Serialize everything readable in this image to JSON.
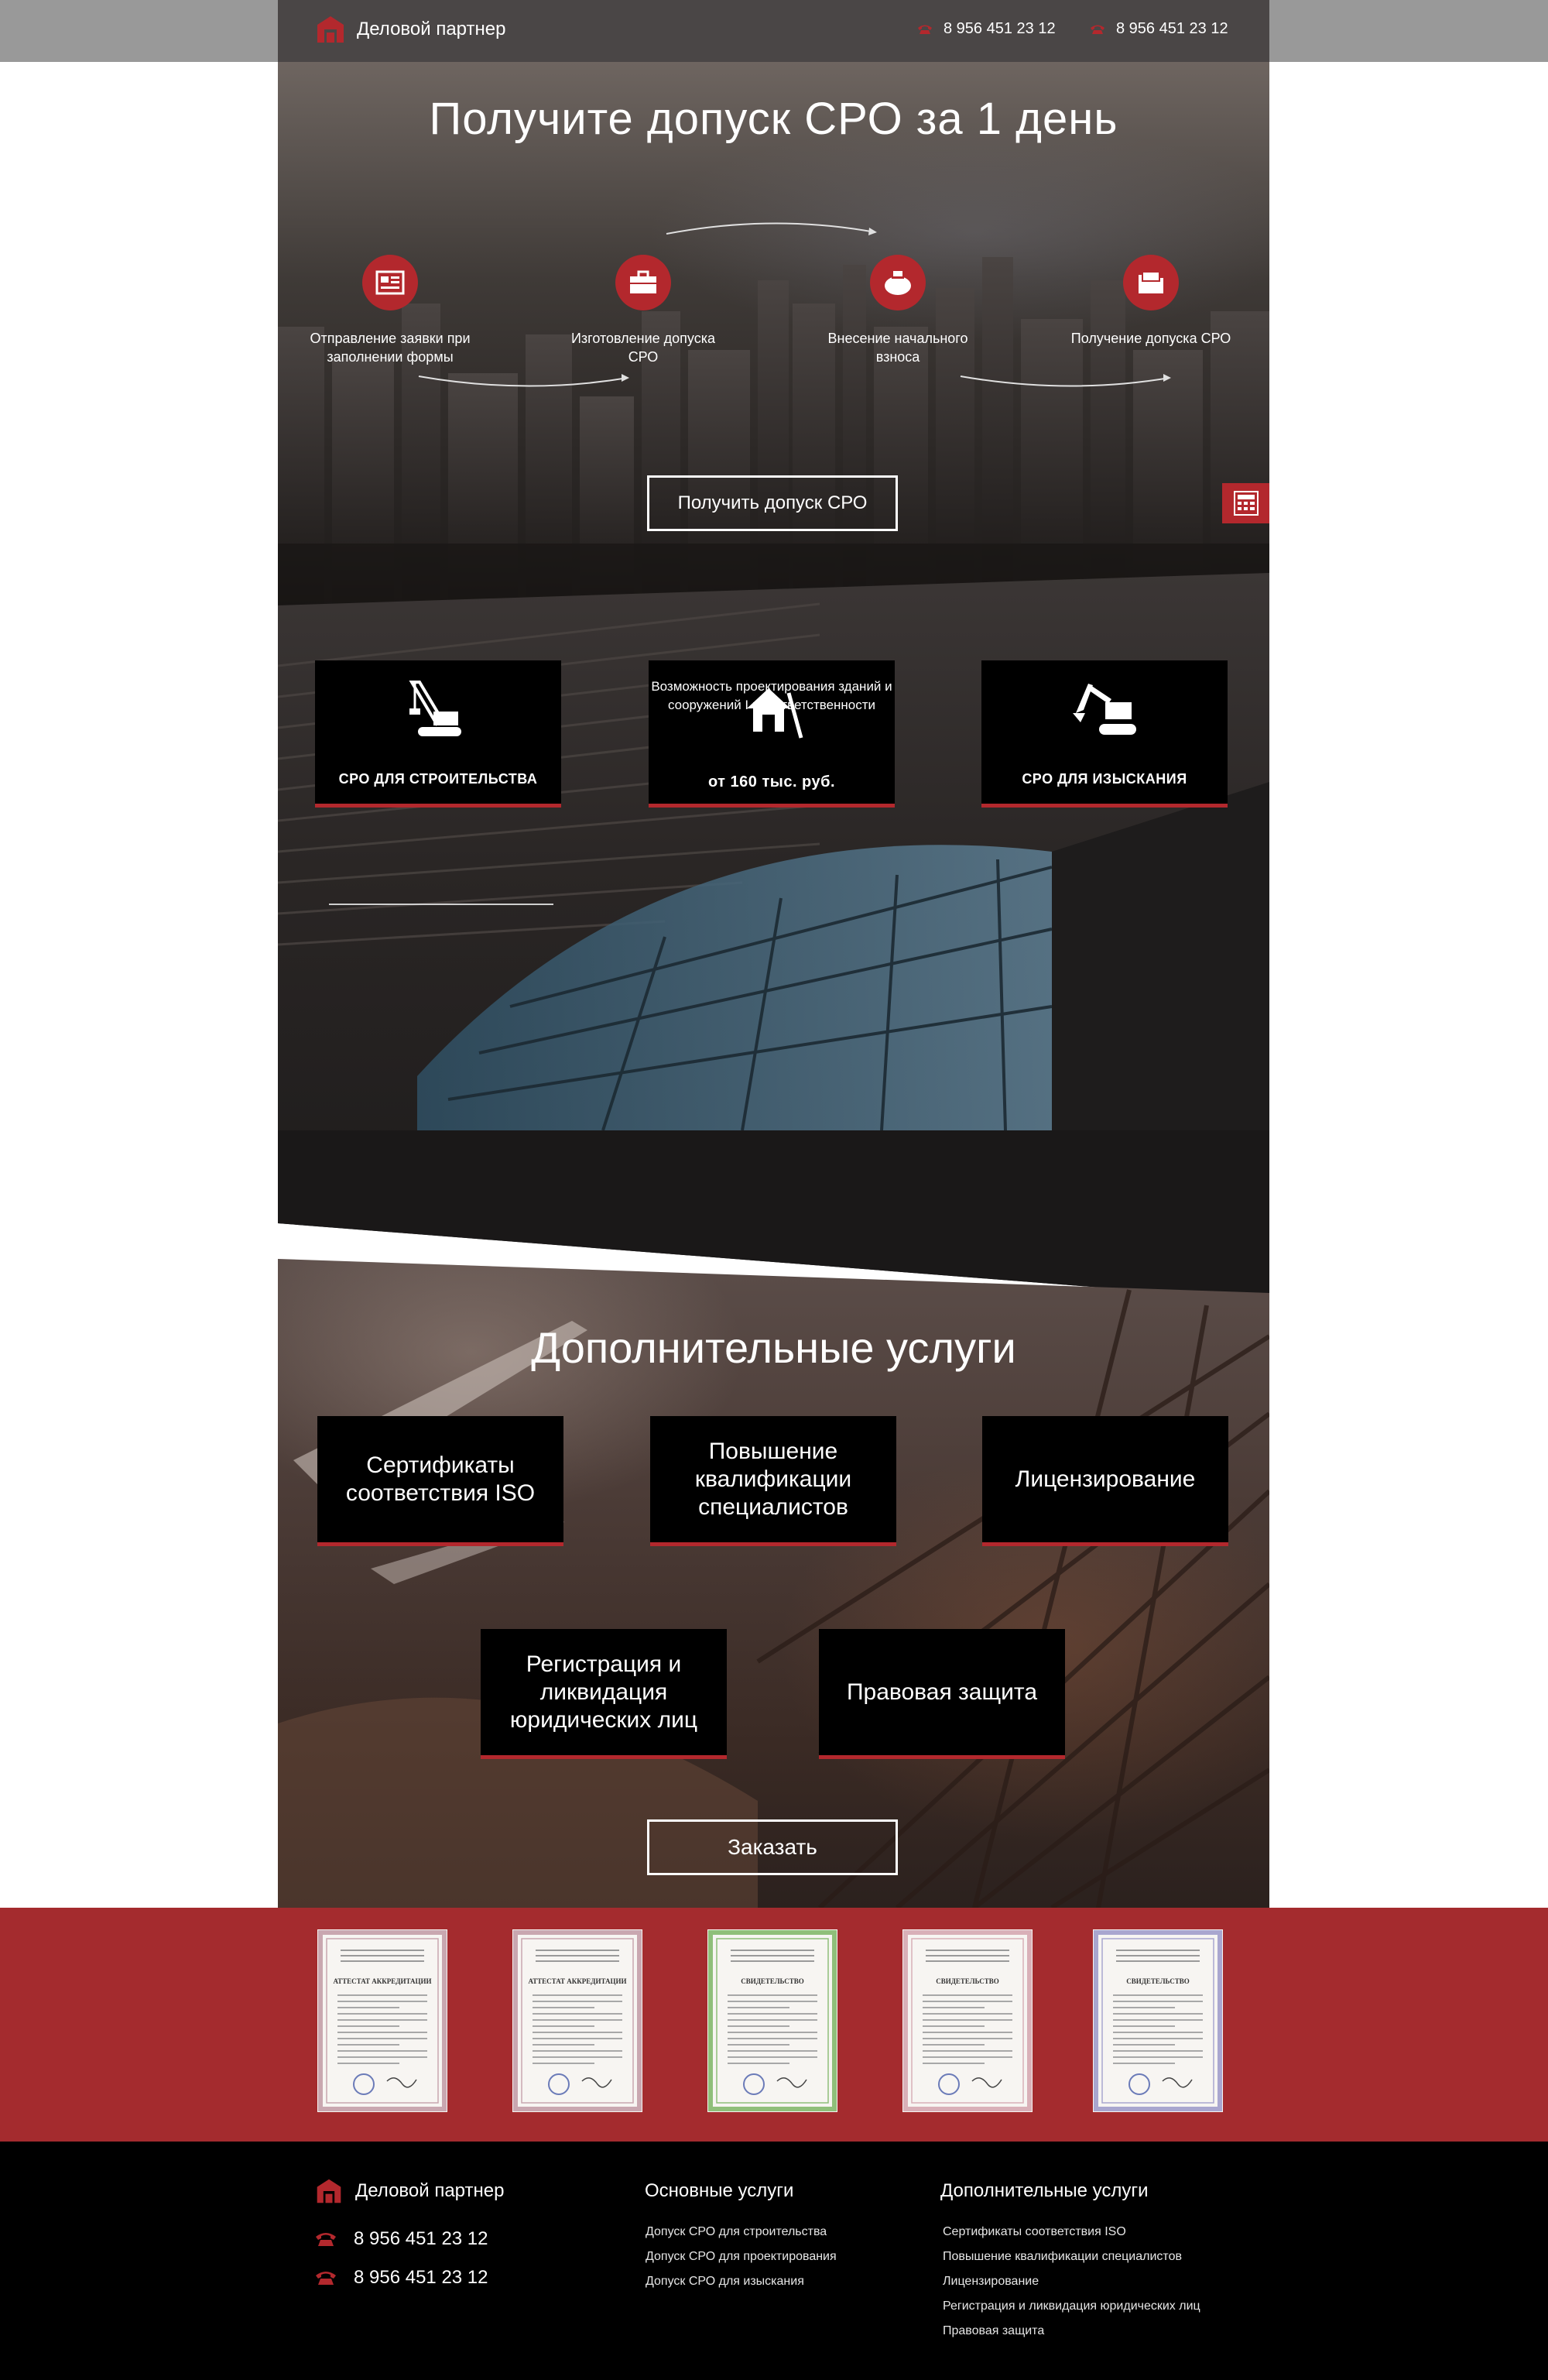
{
  "header": {
    "brand": "Деловой партнер",
    "phones": [
      "8 956 451 23 12",
      "8 956 451 23 12"
    ]
  },
  "hero": {
    "title": "Получите допуск СРО за 1 день",
    "steps": [
      {
        "label": "Отправление заявки при заполнении формы",
        "icon": "application-form-icon"
      },
      {
        "label": "Изготовление допуска СРО",
        "icon": "briefcase-icon"
      },
      {
        "label": "Внесение начального взноса",
        "icon": "money-bag-icon"
      },
      {
        "label": "Получение допуска СРО",
        "icon": "folder-icon"
      }
    ],
    "cta": "Получить допуск СРО",
    "calculator_icon": "calculator-icon"
  },
  "sro": {
    "cards": [
      {
        "title": "СРО ДЛЯ СТРОИТЕЛЬСТВА",
        "icon": "crane-icon"
      },
      {
        "subtitle": "Возможность проектирования зданий и сооружений I и II ответственности",
        "title": "от 160 тыс. руб.",
        "icon": "house-design-icon"
      },
      {
        "title": "СРО ДЛЯ ИЗЫСКАНИЯ",
        "icon": "excavator-icon"
      }
    ]
  },
  "extra": {
    "title": "Дополнительные услуги",
    "services": [
      "Сертификаты соответствия ISO",
      "Повышение квалификации специалистов",
      "Лицензирование",
      "Регистрация и ликвидация юридических лиц",
      "Правовая защита"
    ],
    "cta": "Заказать"
  },
  "certificates": {
    "items": [
      {
        "heading": "АТТЕСТАТ АККРЕДИТАЦИИ",
        "frame": "#c9a7b0"
      },
      {
        "heading": "АТТЕСТАТ АККРЕДИТАЦИИ",
        "frame": "#c9a7b0"
      },
      {
        "heading": "СВИДЕТЕЛЬСТВО",
        "frame": "#8fbf7a"
      },
      {
        "heading": "СВИДЕТЕЛЬСТВО",
        "frame": "#d9b0b8"
      },
      {
        "heading": "СВИДЕТЕЛЬСТВО",
        "frame": "#a9a6cf"
      }
    ]
  },
  "footer": {
    "brand": "Деловой партнер",
    "phones": [
      "8 956 451 23 12",
      "8 956 451 23 12"
    ],
    "main_title": "Основные услуги",
    "main_links": [
      "Допуск СРО для строительства",
      "Допуск СРО для проектирования",
      "Допуск СРО для изыскания"
    ],
    "extra_title": "Дополнительные услуги",
    "extra_links": [
      "Сертификаты соответствия ISO",
      "Повышение квалификации специалистов",
      "Лицензирование",
      "Регистрация и ликвидация юридических лиц",
      "Правовая защита"
    ]
  },
  "colors": {
    "accent": "#b3282d",
    "band": "#a42b2e",
    "card": "#000000"
  }
}
